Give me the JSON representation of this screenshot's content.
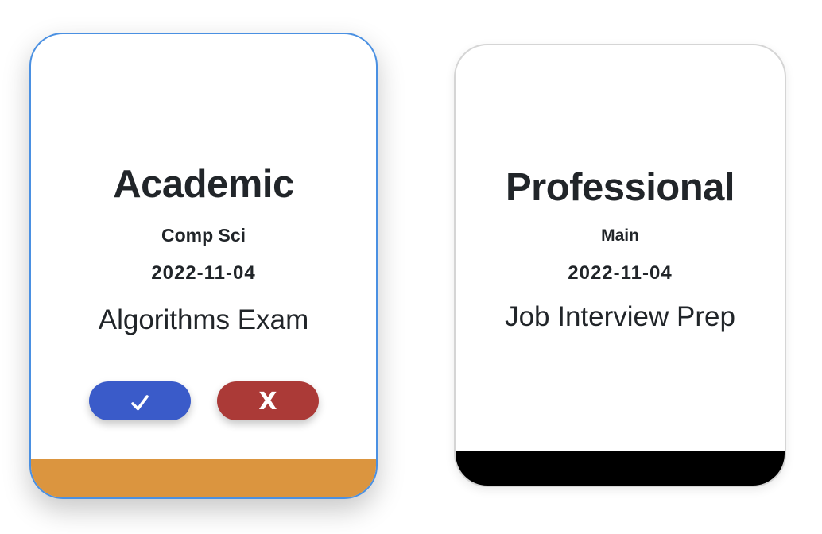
{
  "cards": [
    {
      "category": "Academic",
      "subcategory": "Comp Sci",
      "date": "2022-11-04",
      "title": "Algorithms Exam",
      "confirm_icon": "checkmark-icon",
      "reject_label": "X",
      "footer_color": "#DB953F",
      "selected": true
    },
    {
      "category": "Professional",
      "subcategory": "Main",
      "date": "2022-11-04",
      "title": "Job Interview Prep",
      "footer_color": "#000000",
      "selected": false
    }
  ],
  "colors": {
    "selected_border": "#4a90e2",
    "confirm_button": "#3a5bc9",
    "reject_button": "#ab3a37"
  }
}
